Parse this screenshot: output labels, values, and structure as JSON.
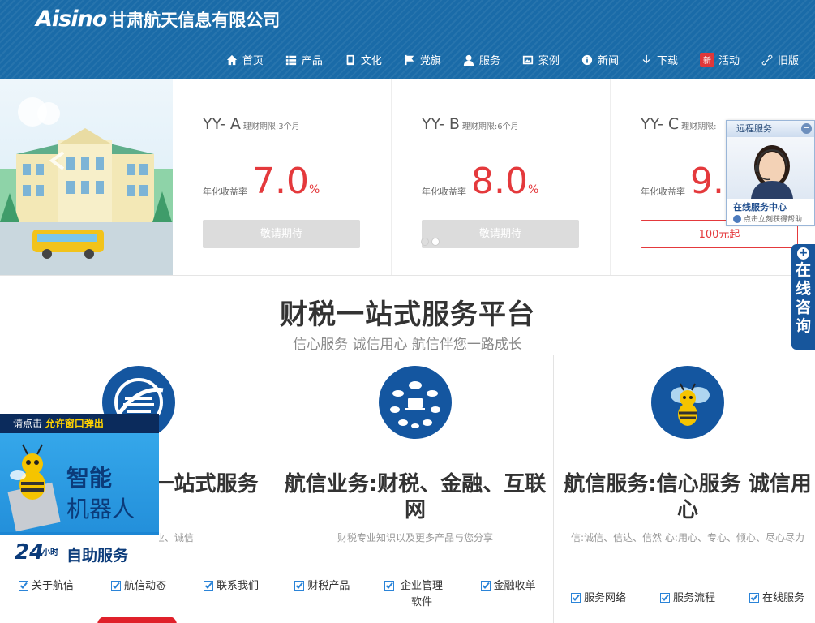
{
  "header": {
    "brand": "Aisino",
    "company": "甘肃航天信息有限公司",
    "nav": [
      {
        "label": "首页",
        "icon": "home-icon"
      },
      {
        "label": "产品",
        "icon": "list-icon"
      },
      {
        "label": "文化",
        "icon": "book-icon"
      },
      {
        "label": "党旗",
        "icon": "flag-icon"
      },
      {
        "label": "服务",
        "icon": "user-icon"
      },
      {
        "label": "案例",
        "icon": "picture-icon"
      },
      {
        "label": "新闻",
        "icon": "info-icon"
      },
      {
        "label": "下载",
        "icon": "download-icon"
      },
      {
        "label": "活动",
        "icon": "new-badge",
        "badge": "新"
      },
      {
        "label": "旧版",
        "icon": "link-icon"
      }
    ]
  },
  "products": [
    {
      "name": "YY- A",
      "term": "理财期限:3个月",
      "rate_label": "年化收益率",
      "rate": "7.0",
      "unit": "%",
      "button": "敬请期待",
      "state": "disabled"
    },
    {
      "name": "YY- B",
      "term": "理财期限:6个月",
      "rate_label": "年化收益率",
      "rate": "8.0",
      "unit": "%",
      "button": "敬请期待",
      "state": "disabled"
    },
    {
      "name": "YY- C",
      "term": "理财期限:",
      "rate_label": "年化收益率",
      "rate": "9.0",
      "unit": "%",
      "button": "100元起",
      "state": "active"
    }
  ],
  "service_float": {
    "title": "远程服务",
    "minimize": "−",
    "online": "在线服务中心",
    "help": "点击立刻获得帮助"
  },
  "consult": {
    "plus": "+",
    "text": "在线咨询"
  },
  "section": {
    "title": "财税一站式服务平台",
    "subtitle": "信心服务  诚信用心  航信伴您一路成长"
  },
  "columns": [
    {
      "heading": "航天信息产业  一站式服务",
      "desc": "航天信息产业 专业、诚信",
      "links": [
        "关于航信",
        "航信动态",
        "联系我们"
      ]
    },
    {
      "heading": "航信业务:财税、金融、互联网",
      "desc": "财税专业知识以及更多产品与您分享",
      "links": [
        "财税产品",
        "企业管理软件",
        "金融收单"
      ]
    },
    {
      "heading": "航信服务:信心服务  诚信用心",
      "desc": "信:诚信、信达、信然  心:用心、专心、倾心、尽心尽力",
      "links": [
        "服务网络",
        "服务流程",
        "在线服务"
      ]
    }
  ],
  "robot": {
    "bar_prefix": "请点击",
    "bar_highlight": "允许窗口弹出",
    "line1": "智能",
    "line2": "机器人",
    "hours": "24",
    "hours_unit": "小时",
    "self_service": "自助服务"
  },
  "colors": {
    "header_blue": "#1a6ba8",
    "accent_red": "#e4393c",
    "icon_blue": "#1456a0"
  }
}
